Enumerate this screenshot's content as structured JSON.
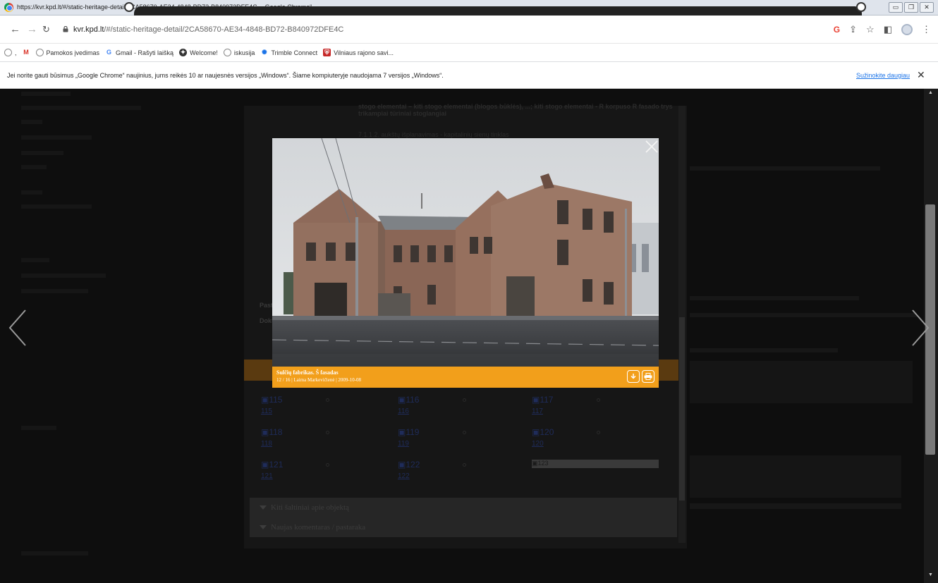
{
  "window": {
    "title": "https://kvr.kpd.lt/#/static-heritage-detail/2CA58670-AE34-4848-BD72-B840972DFE4C - „Google Chrome“"
  },
  "toolbar": {
    "url_host": "kvr.kpd.lt",
    "url_path": "/#/static-heritage-detail/2CA58670-AE34-4848-BD72-B840972DFE4C"
  },
  "bookmarks": {
    "items": [
      {
        "label": "Pamokos įvedimas",
        "icon": "globe-icon"
      },
      {
        "label": "Gmail - Rašyti laišką",
        "icon": "google-icon"
      },
      {
        "label": "Welcome!",
        "icon": "compass-icon"
      },
      {
        "label": "iskusija",
        "icon": "globe-icon"
      },
      {
        "label": "Trimble Connect",
        "icon": "trimble-icon"
      },
      {
        "label": "Vilniaus rajono savi...",
        "icon": "shield-icon"
      }
    ]
  },
  "infobar": {
    "message": "Jei norite gauti būsimus „Google Chrome“ naujinius, jums reikės 10 ar naujesnės versijos „Windows“. Šiame kompiuteryje naudojama 7 versijos „Windows“.",
    "learn_more": "Sužinokite daugiau"
  },
  "page": {
    "panel_text_1": "stogo elementai – kiti stogo elementai (blogos būklės), ...; kiti stogo elementai - R korpuso R fasado trys trikampiai türiniai stoglangiai",
    "panel_text_2": "7.1.1.2. aukštų išplanavimas - kapitalinių sienų tinklas",
    "left_label_1": "Past",
    "left_label_2": "Doku",
    "bars": [
      {
        "label": "Kiti šaltiniai apie objektą"
      },
      {
        "label": "Naujas komentaras / pastaraka"
      }
    ],
    "thumbs": [
      {
        "img": "115",
        "caption": "115"
      },
      {
        "img": "116",
        "caption": "116"
      },
      {
        "img": "117",
        "caption": "117"
      },
      {
        "img": "118",
        "caption": "118"
      },
      {
        "img": "119",
        "caption": "119"
      },
      {
        "img": "120",
        "caption": "120"
      },
      {
        "img": "121",
        "caption": "121"
      },
      {
        "img": "122",
        "caption": "122"
      },
      {
        "img": "123",
        "caption": ""
      }
    ]
  },
  "lightbox": {
    "title": "Sulčių fabrikas. Š fasadas",
    "meta": "12 / 16 | Laima Markevičienė | 2009-10-08"
  },
  "colors": {
    "caption_bar": "#f29f1b",
    "overlay": "#0c0c0c"
  }
}
